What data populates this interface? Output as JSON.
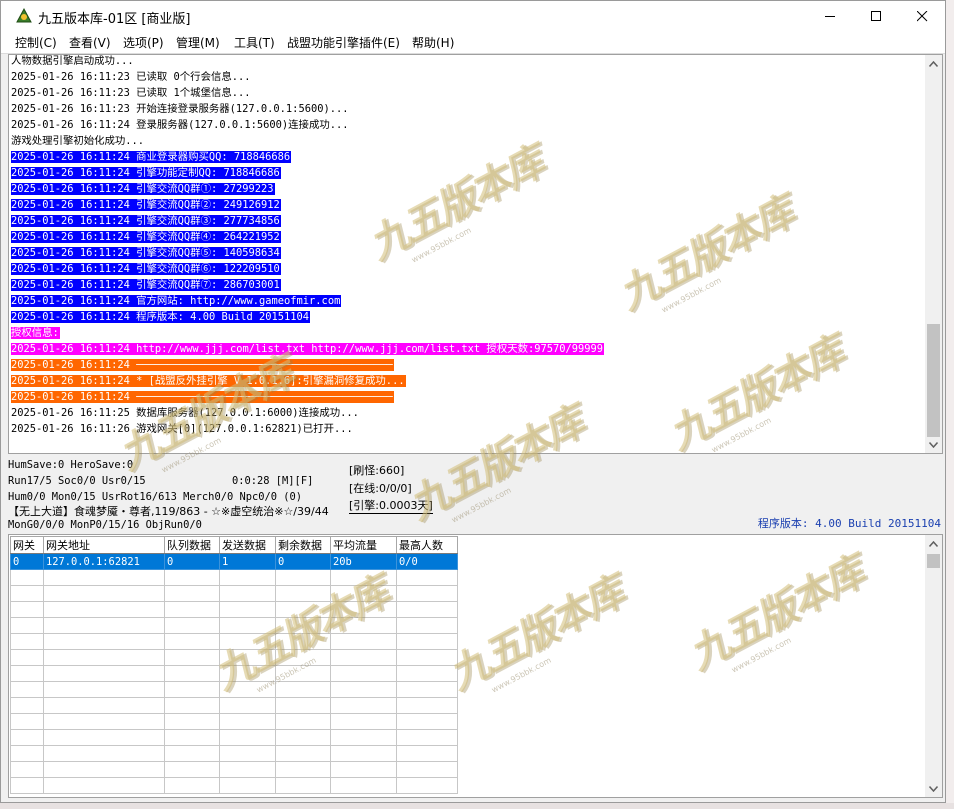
{
  "window": {
    "title": "九五版本库-01区 [商业版]",
    "accent_color": "#0078d7"
  },
  "menu": [
    {
      "label": "控制(C)"
    },
    {
      "label": "查看(V)"
    },
    {
      "label": "选项(P)"
    },
    {
      "label": "管理(M)"
    },
    {
      "label": "工具(T)"
    },
    {
      "label": "战盟功能引擎插件(E)"
    },
    {
      "label": "帮助(H)"
    }
  ],
  "log": [
    {
      "text": "人物数据引擎启动成功...",
      "style": "normal"
    },
    {
      "text": "2025-01-26 16:11:23 已读取 0个行会信息...",
      "style": "normal"
    },
    {
      "text": "2025-01-26 16:11:23 已读取 1个城堡信息...",
      "style": "normal"
    },
    {
      "text": "2025-01-26 16:11:23 开始连接登录服务器(127.0.0.1:5600)...",
      "style": "normal"
    },
    {
      "text": "2025-01-26 16:11:24 登录服务器(127.0.0.1:5600)连接成功...",
      "style": "normal"
    },
    {
      "text": "游戏处理引擎初始化成功...",
      "style": "normal"
    },
    {
      "text": "2025-01-26 16:11:24 商业登录器购买QQ: 718846686",
      "style": "blue"
    },
    {
      "text": "2025-01-26 16:11:24 引擎功能定制QQ: 718846686",
      "style": "blue"
    },
    {
      "text": "2025-01-26 16:11:24 引擎交流QQ群①: 27299223",
      "style": "blue"
    },
    {
      "text": "2025-01-26 16:11:24 引擎交流QQ群②: 249126912",
      "style": "blue"
    },
    {
      "text": "2025-01-26 16:11:24 引擎交流QQ群③: 277734856",
      "style": "blue"
    },
    {
      "text": "2025-01-26 16:11:24 引擎交流QQ群④: 264221952",
      "style": "blue"
    },
    {
      "text": "2025-01-26 16:11:24 引擎交流QQ群⑤: 140598634",
      "style": "blue"
    },
    {
      "text": "2025-01-26 16:11:24 引擎交流QQ群⑥: 122209510",
      "style": "blue"
    },
    {
      "text": "2025-01-26 16:11:24 引擎交流QQ群⑦: 286703001",
      "style": "blue"
    },
    {
      "text": "2025-01-26 16:11:24 官方网站: http://www.gameofmir.com",
      "style": "blue"
    },
    {
      "text": "2025-01-26 16:11:24 程序版本: 4.00 Build 20151104",
      "style": "blue"
    },
    {
      "text": "授权信息:",
      "style": "magenta"
    },
    {
      "text": "2025-01-26 16:11:24 http://www.jjj.com/list.txt http://www.jjj.com/list.txt 授权天数:97570/99999",
      "style": "magenta"
    },
    {
      "text": "2025-01-26 16:11:24 ─────────────────────────────────────────",
      "style": "orange"
    },
    {
      "text": "2025-01-26 16:11:24 * [战盟反外挂引擎 V 1.0.1.6]:引擎漏洞修复成功...",
      "style": "orange"
    },
    {
      "text": "2025-01-26 16:11:24 ─────────────────────────────────────────",
      "style": "orange"
    },
    {
      "text": "2025-01-26 16:11:25 数据库服务器(127.0.0.1:6000)连接成功...",
      "style": "normal"
    },
    {
      "text": "2025-01-26 16:11:26 游戏网关[0](127.0.0.1:62821)已打开...",
      "style": "normal"
    }
  ],
  "status": {
    "line1": "HumSave:0 HeroSave:0",
    "line2a": "Run17/5 Soc0/0 Usr0/15",
    "line2b": "0:0:28 [M][F]",
    "line3": "Hum0/0 Mon0/15 UsrRot16/613 Merch0/0 Npc0/0 (0)",
    "line4": "【无上大道】食魂梦魇・尊者,119/863 - ☆※虚空统治※☆/39/44",
    "line5": "MonG0/0/0 MonP0/15/16 ObjRun0/0",
    "refresh_monster": "[刷怪:660]",
    "online": "[在线:0/0/0]",
    "engine": "[引擎:0.0003天]",
    "version": "程序版本: 4.00 Build 20151104"
  },
  "grid": {
    "columns": [
      "网关",
      "网关地址",
      "队列数据",
      "发送数据",
      "剩余数据",
      "平均流量",
      "最高人数"
    ],
    "rows": [
      [
        "0",
        "127.0.0.1:62821",
        "0",
        "1",
        "0",
        "20b",
        "0/0"
      ]
    ]
  },
  "watermark": {
    "main": "九五版本库",
    "sub": "www.95bbk.com"
  }
}
